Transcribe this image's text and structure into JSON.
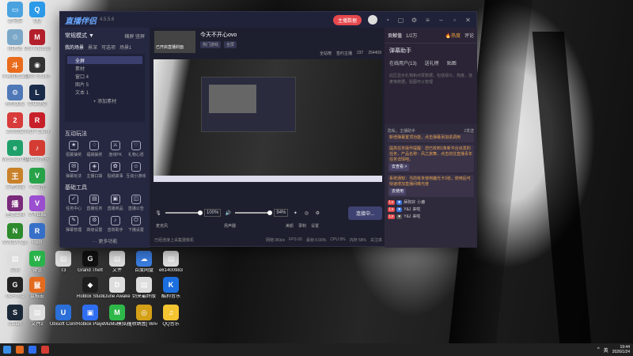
{
  "desktop": {
    "icons": [
      {
        "label": "此电脑",
        "color": "#4aa3df",
        "glyph": "▭"
      },
      {
        "label": "QQ",
        "color": "#2b9ae8",
        "glyph": "Q"
      },
      {
        "label": "回收站",
        "color": "#7aa7c7",
        "glyph": "♲"
      },
      {
        "label": "MSI Afterburner",
        "color": "#b3202b",
        "glyph": "M"
      },
      {
        "label": "斗鱼直播工具",
        "color": "#e96b1c",
        "glyph": "斗"
      },
      {
        "label": "OBS Studio",
        "color": "#333",
        "glyph": "◉"
      },
      {
        "label": "控制面板",
        "color": "#4f78b8",
        "glyph": "⚙"
      },
      {
        "label": "英雄联盟",
        "color": "#1b2b4a",
        "glyph": "L"
      },
      {
        "label": "299商城",
        "color": "#d83b3b",
        "glyph": "2"
      },
      {
        "label": "RIOT Client",
        "color": "#c8202b",
        "glyph": "R"
      },
      {
        "label": "Microsoft Edge",
        "color": "#1fa06a",
        "glyph": "e"
      },
      {
        "label": "网易云音乐",
        "color": "#d43c33",
        "glyph": "♪"
      },
      {
        "label": "王者荣耀",
        "color": "#c9812a",
        "glyph": "王"
      },
      {
        "label": "VS调音",
        "color": "#29a34a",
        "glyph": "V"
      },
      {
        "label": "主播工具",
        "color": "#7a2a7a",
        "glyph": "播"
      },
      {
        "label": "VPNLite",
        "color": "#9b4fd0",
        "glyph": "V"
      },
      {
        "label": "NVIDIA App",
        "color": "#2d8a2d",
        "glyph": "N"
      },
      {
        "label": "Rem",
        "color": "#3670c8",
        "glyph": "R"
      },
      {
        "label": "文档",
        "color": "#ddd",
        "glyph": "▤"
      },
      {
        "label": "微信",
        "color": "#29b34a",
        "glyph": "W"
      },
      {
        "label": "T3",
        "color": "#ddd",
        "glyph": "▤"
      },
      {
        "label": "Grand Theft",
        "color": "#111",
        "glyph": "G"
      },
      {
        "label": "文件",
        "color": "#ddd",
        "glyph": "▤"
      },
      {
        "label": "百度网盘",
        "color": "#3a7de0",
        "glyph": "☁"
      },
      {
        "label": "e61400983",
        "color": "#ddd",
        "glyph": "▤"
      },
      {
        "label": "GeForce",
        "color": "#222",
        "glyph": "G"
      },
      {
        "label": "鼠标宏",
        "color": "#e36a1f",
        "glyph": "鼠"
      },
      {
        "label": "Roblox Studio",
        "color": "#1d1d1d",
        "glyph": "◆"
      },
      {
        "label": "Dune Awakening",
        "color": "#ddd",
        "glyph": "D"
      },
      {
        "label": "剑来最终版",
        "color": "#ddd",
        "glyph": "▤"
      },
      {
        "label": "酷狗音乐",
        "color": "#1c6fe0",
        "glyph": "K"
      },
      {
        "label": "Steam",
        "color": "#1b2838",
        "glyph": "S"
      },
      {
        "label": "文件2",
        "color": "#ddd",
        "glyph": "▤"
      },
      {
        "label": "Ubisoft Connect",
        "color": "#2b6fd8",
        "glyph": "U"
      },
      {
        "label": "Roblox Player",
        "color": "#2f6ef0",
        "glyph": "▣"
      },
      {
        "label": "MuMu模拟器",
        "color": "#2fb84a",
        "glyph": "M"
      },
      {
        "label": "[收纳盒] WA47",
        "color": "#d4a017",
        "glyph": "◎"
      },
      {
        "label": "QQ音乐",
        "color": "#f4c431",
        "glyph": "♫"
      }
    ]
  },
  "window": {
    "app_name": "直播伴侣",
    "version": "4.5.5.6",
    "title_pill": "主播数据",
    "left": {
      "mode_label": "常规模式 ▼",
      "mode_right": "横屏  竖屏",
      "tabs": [
        "我的场景",
        "景深",
        "可选项",
        "场景1"
      ],
      "scenes": [
        "全屏",
        "素材",
        "窗口 4",
        "图片 5",
        "文本 1"
      ],
      "add_material": "+ 添加素材",
      "interactive_title": "互动玩法",
      "interactive_tools": [
        "招募抽奖",
        "福袋抽奖",
        "连线PK",
        "礼物心愿",
        "弹幕玩法",
        "主播口袋",
        "贴纸故事",
        "互动小游戏"
      ],
      "basic_title": "基础工具",
      "basic_tools": [
        "任务中心",
        "直播任务",
        "直播商品",
        "直播公告",
        "弹幕管理",
        "高级设置",
        "音效助手",
        "下播设置"
      ],
      "more_label": "··· 更多功能"
    },
    "center": {
      "stream_title": "今天不开心ovo",
      "thumb_tag": "已开启直播封面",
      "category_a": "热门游戏",
      "category_b": "全屏",
      "room_tags": [
        "全站榜",
        "签约主播"
      ],
      "stats": [
        "237",
        "254409"
      ],
      "mic_label": "麦克风",
      "mic_pct": "100%",
      "spk_label": "扬声器",
      "spk_pct": "94%",
      "tools": [
        "美颜",
        "录制",
        "设置"
      ],
      "go_button": "连接中...",
      "status_hint": "已经连接上采集摄像机",
      "status_stats": [
        "网络 0Kb/s",
        "FPS 60",
        "丢帧 0.00%",
        "CPU 8%",
        "内存 58%",
        "关注率"
      ]
    },
    "right": {
      "tabs": [
        "贡献值",
        "1/2万",
        "热度",
        "评论"
      ],
      "hot_label": "🔥热度",
      "assistant_title": "弹幕助手",
      "sub_tabs": [
        "在线用户(13)",
        "送礼榜",
        "贴图"
      ],
      "empty_hint": "此区显示礼物和点赞数据，包括观众，热度，连麦等数据，贴图可以管理",
      "chat_header": "隐私，主播助手",
      "chat_count": "2发送",
      "messages": [
        "新增弹幕置顶功能，点击弹幕添加进调用",
        "提高任务操作提醒：您已收到1条新平台派发的任务，产品名称：风之旅舞，点击前往直播青年任务详情吧。",
        "系统通知：当前有未使用魔光卡3张，使用后可快速增加直播间曝光度"
      ],
      "btn_go": "去查看 >",
      "btn_use": "去使用",
      "chat_users": [
        "舔狗好",
        "小鹿",
        "Y&J",
        "Y&J"
      ],
      "chat_texts": [
        "来啦",
        "来啦",
        "来啦"
      ]
    }
  },
  "taskbar": {
    "time": "19:44",
    "date": "2026/1/24",
    "lang": "英"
  }
}
